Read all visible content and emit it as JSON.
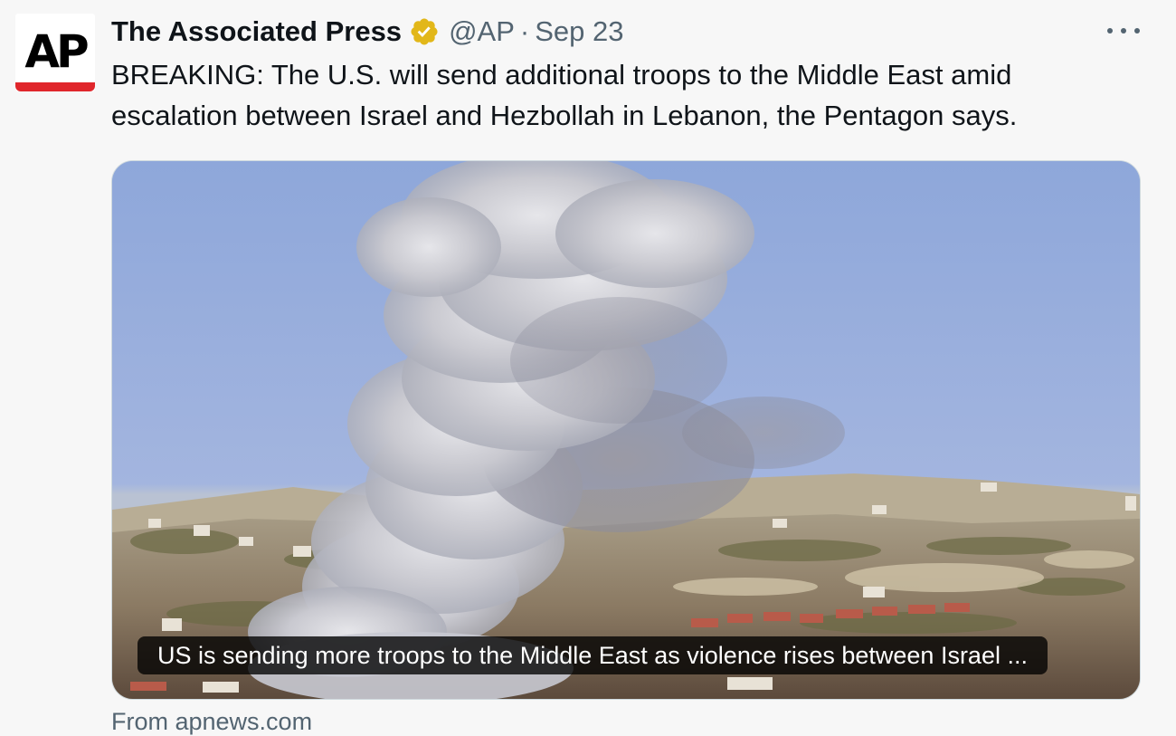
{
  "tweet": {
    "author": {
      "display_name": "The Associated Press",
      "handle": "@AP",
      "avatar_text": "AP",
      "verified_icon": "verified-gold-badge-icon"
    },
    "separator": "·",
    "date": "Sep 23",
    "more_icon": "more-options-icon",
    "text": "BREAKING: The U.S. will send additional troops to the Middle East amid escalation between Israel and Hezbollah in Lebanon, the Pentagon says.",
    "link_card": {
      "image_description_icon": "photo-smoke-plume",
      "caption": "US is sending more troops to the Middle East as violence rises between Israel ...",
      "source": "From apnews.com"
    }
  },
  "colors": {
    "brand_red": "#e0262b",
    "verified_gold": "#e2b719",
    "text_primary": "#0f1419",
    "text_secondary": "#536471",
    "background": "#f7f7f7"
  }
}
